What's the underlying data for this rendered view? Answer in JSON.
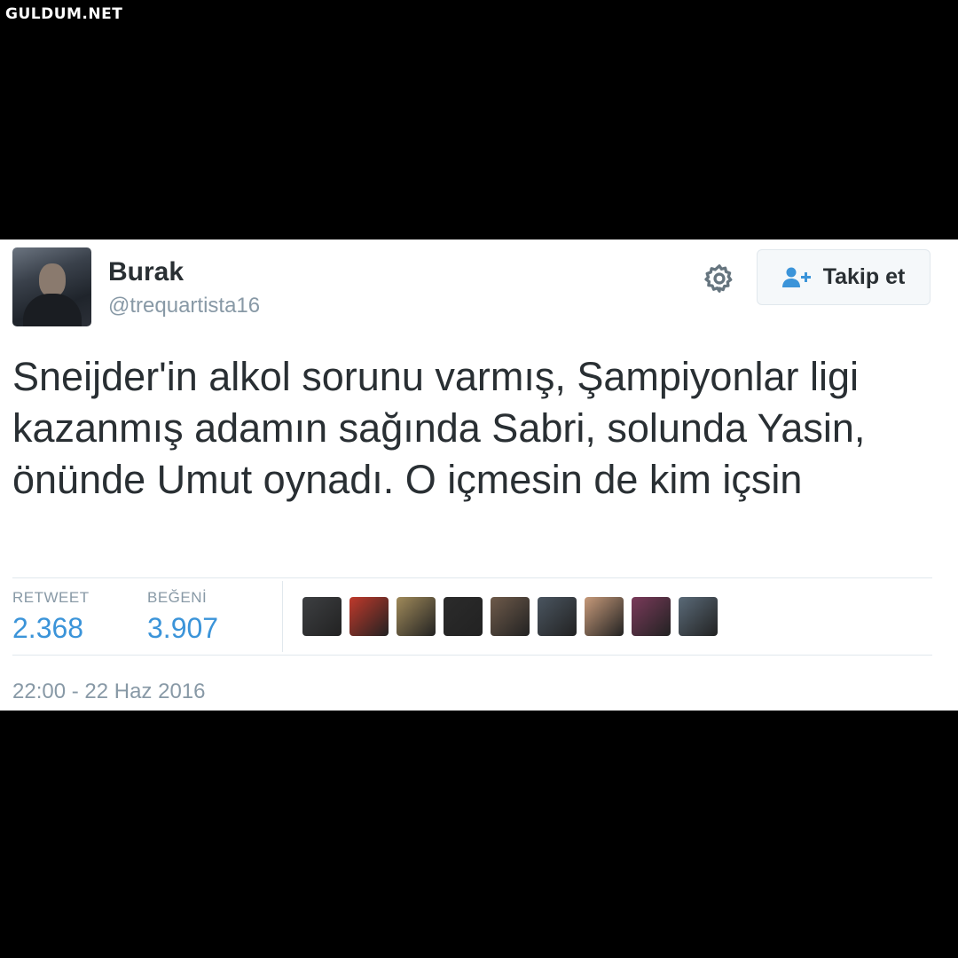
{
  "watermark": "GULDUM.NET",
  "tweet": {
    "author_name": "Burak",
    "author_handle": "@trequartista16",
    "follow_label": "Takip et",
    "text": "Sneijder'in alkol sorunu varmış, Şampiyonlar ligi kazanmış adamın sağında Sabri, solunda Yasin, önünde Umut oynadı. O içmesin de kim içsin",
    "retweet_label": "RETWEET",
    "retweet_count": "2.368",
    "like_label": "BEĞENİ",
    "like_count": "3.907",
    "timestamp": "22:00 - 22 Haz 2016"
  },
  "icons": {
    "settings": "gear-icon",
    "follow": "add-user-icon"
  },
  "colors": {
    "link_blue": "#3b94d9",
    "muted_gray": "#8899a6",
    "text_dark": "#292f33"
  },
  "likers": [
    {
      "color": "#3d3f42"
    },
    {
      "color": "#c0392b"
    },
    {
      "color": "#a08a5a"
    },
    {
      "color": "#2b2b2b"
    },
    {
      "color": "#6e5a4a"
    },
    {
      "color": "#4a5560"
    },
    {
      "color": "#c79a7a"
    },
    {
      "color": "#7a3a5a"
    },
    {
      "color": "#5a6a78"
    }
  ]
}
